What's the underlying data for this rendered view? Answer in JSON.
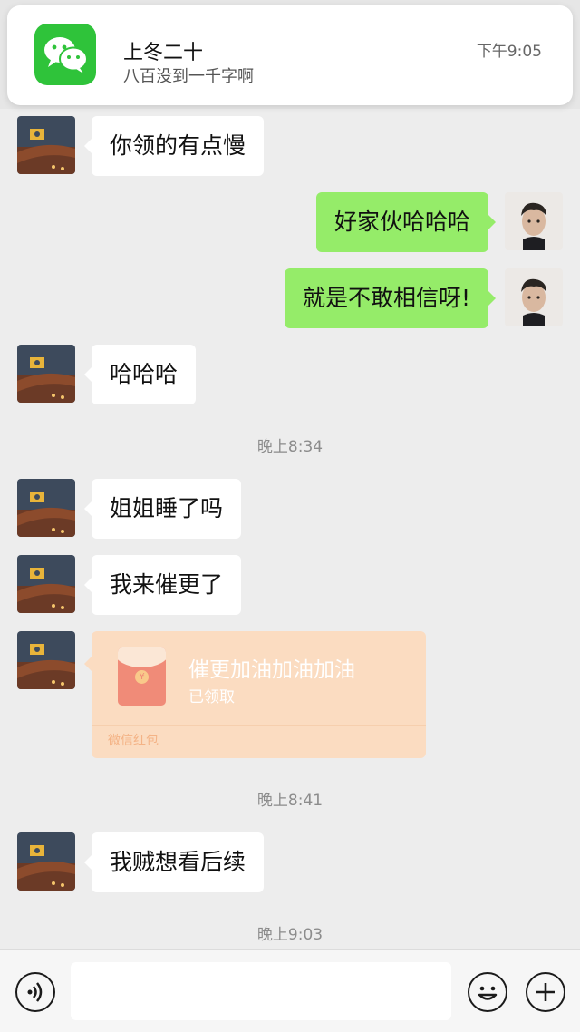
{
  "notification": {
    "app_icon": "wechat-icon",
    "sender": "上冬二十",
    "message": "八百没到一千字啊",
    "time": "下午9:05"
  },
  "messages": [
    {
      "side": "in",
      "text": "你领的有点慢"
    },
    {
      "side": "out",
      "text": "好家伙哈哈哈"
    },
    {
      "side": "out",
      "text": "就是不敢相信呀!"
    },
    {
      "side": "in",
      "text": "哈哈哈"
    }
  ],
  "timestamps": [
    "晚上8:34",
    "晚上8:41",
    "晚上9:03"
  ],
  "messages2": [
    {
      "side": "in",
      "text": "姐姐睡了吗"
    },
    {
      "side": "in",
      "text": "我来催更了"
    }
  ],
  "red_packet": {
    "title": "催更加油加油加油",
    "status": "已领取",
    "footer": "微信红包",
    "color": "#fbdcc1"
  },
  "messages3": [
    {
      "side": "in",
      "text": "我贼想看后续"
    }
  ],
  "input_bar": {
    "voice_icon": "voice-icon",
    "emoji_icon": "emoji-icon",
    "plus_icon": "plus-icon",
    "value": ""
  },
  "colors": {
    "outgoing_bubble": "#95ec69",
    "incoming_bubble": "#ffffff",
    "background": "#ededed"
  }
}
